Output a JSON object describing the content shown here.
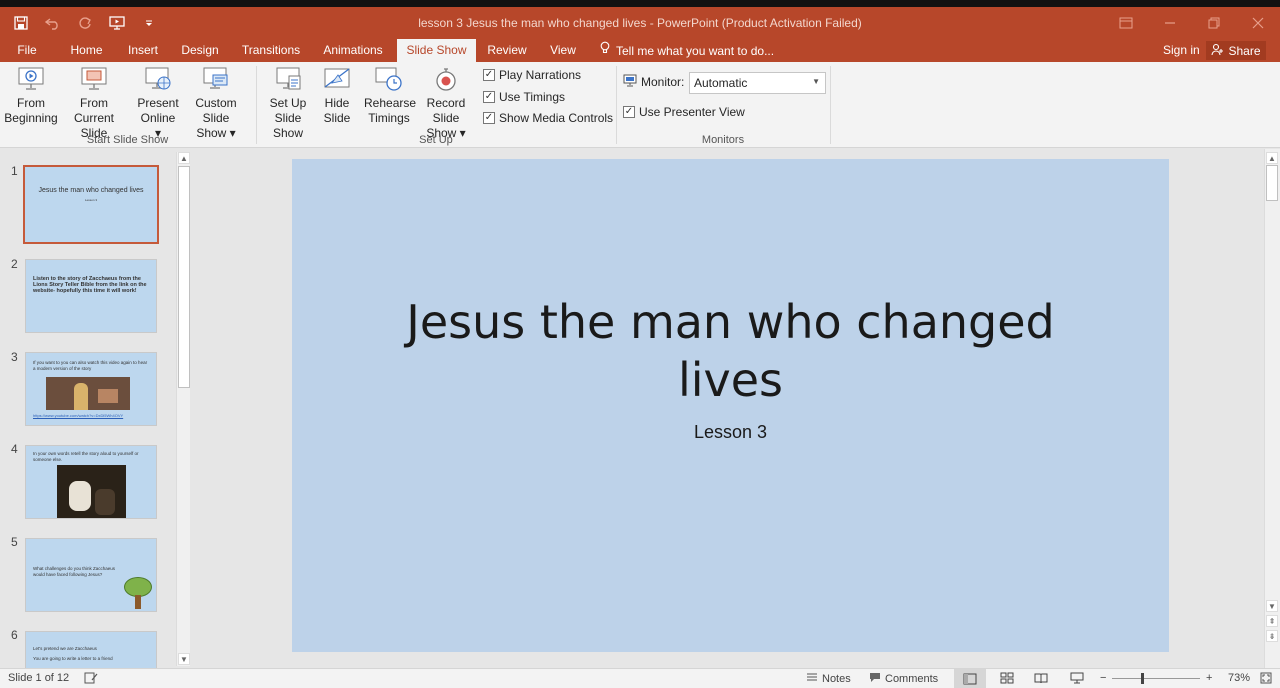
{
  "window": {
    "title": "lesson 3 Jesus the man who changed lives - PowerPoint (Product Activation Failed)"
  },
  "tabs": [
    "File",
    "Home",
    "Insert",
    "Design",
    "Transitions",
    "Animations",
    "Slide Show",
    "Review",
    "View"
  ],
  "tell_me": "Tell me what you want to do...",
  "sign_in": "Sign in",
  "share": "Share",
  "ribbon": {
    "start_group": {
      "label": "Start Slide Show",
      "from_beginning": [
        "From",
        "Beginning"
      ],
      "from_current": [
        "From",
        "Current Slide"
      ],
      "present_online": [
        "Present",
        "Online ▾"
      ],
      "custom_show": [
        "Custom Slide",
        "Show ▾"
      ]
    },
    "setup_group": {
      "label": "Set Up",
      "setup_show": [
        "Set Up",
        "Slide Show"
      ],
      "hide_slide": [
        "Hide",
        "Slide"
      ],
      "rehearse": [
        "Rehearse",
        "Timings"
      ],
      "record": [
        "Record Slide",
        "Show ▾"
      ],
      "play_narrations": "Play Narrations",
      "use_timings": "Use Timings",
      "show_media_controls": "Show Media Controls"
    },
    "monitors_group": {
      "label": "Monitors",
      "monitor_label": "Monitor:",
      "monitor_value": "Automatic",
      "use_presenter_view": "Use Presenter View"
    }
  },
  "thumbnails": [
    {
      "num": "1",
      "text": "Jesus the man who changed lives",
      "sub": "Lesson 3"
    },
    {
      "num": "2",
      "text": "Listen to the story of Zacchaeus from the Lions Story Teller Bible from the link on the website- hopefully this time it will work!"
    },
    {
      "num": "3",
      "text": "If you want to you can also watch this video again to hear a modern version of the story",
      "link": "https://www.youtube.com/watch?v=DxDl5Wh4OVY"
    },
    {
      "num": "4",
      "text": "In your own words retell the story aloud to yourself or someone else."
    },
    {
      "num": "5",
      "text": "What challenges do you think Zacchaeus would have faced following Jesus?"
    },
    {
      "num": "6",
      "text": "Let's pretend we are Zacchaeus",
      "text2": "You are going to write a letter to a friend"
    }
  ],
  "slide": {
    "title_line1": "Jesus the man who changed",
    "title_line2": "lives",
    "subtitle": "Lesson 3"
  },
  "status": {
    "slide_of": "Slide 1 of 12",
    "notes": "Notes",
    "comments": "Comments",
    "zoom": "73%",
    "zoom_fraction": 0.73
  },
  "colors": {
    "accent": "#b7472a",
    "slide_bg": "#bdd2e9"
  }
}
